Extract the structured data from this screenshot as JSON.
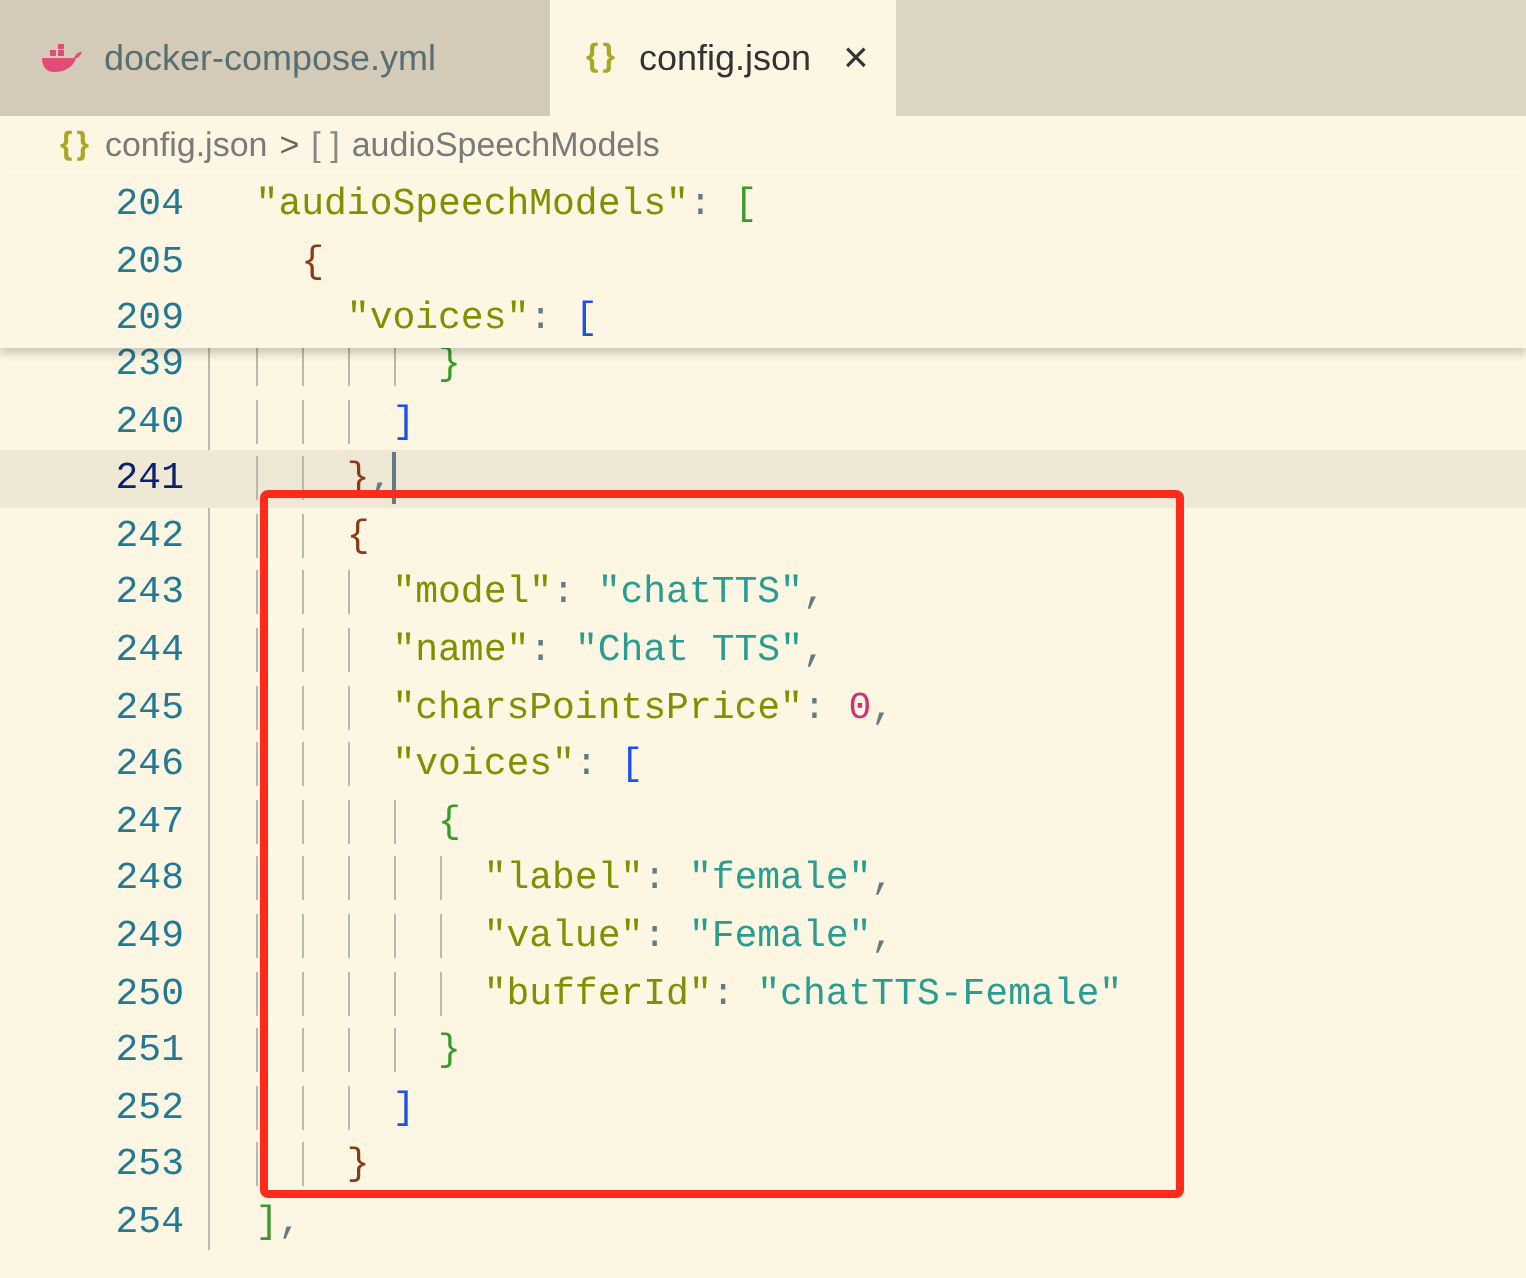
{
  "tabs": [
    {
      "label": "docker-compose.yml",
      "selected": false
    },
    {
      "label": "config.json",
      "icon_glyph": "{}",
      "close": "×",
      "selected": true
    }
  ],
  "breadcrumb": [
    {
      "glyph": "{}",
      "label": "config.json",
      "kind": "file"
    },
    {
      "glyph": ">",
      "kind": "separator"
    },
    {
      "glyph": "[ ]",
      "label": "audioSpeechModels",
      "kind": "array"
    }
  ],
  "editor": {
    "sticky_lines": [
      {
        "number": "204",
        "tokens": [
          {
            "text": "  \"audioSpeechModels\"",
            "kind": "key"
          },
          {
            "text": ": ",
            "kind": "punct"
          },
          {
            "text": "[",
            "kind": "bracket",
            "color": "#3a9b2a"
          }
        ]
      },
      {
        "number": "205",
        "tokens": [
          {
            "text": "    {",
            "kind": "bracket",
            "color": "#8b3a1a"
          }
        ]
      },
      {
        "number": "209",
        "tokens": [
          {
            "text": "      \"voices\"",
            "kind": "key"
          },
          {
            "text": ": ",
            "kind": "punct"
          },
          {
            "text": "[",
            "kind": "bracket",
            "color": "#1a4ff0"
          }
        ]
      }
    ],
    "lines": [
      {
        "number": "239",
        "current": false,
        "cursor": false,
        "tokens": [
          {
            "text": "          }",
            "kind": "bracket",
            "color": "#3a9b2a"
          }
        ]
      },
      {
        "number": "240",
        "current": false,
        "cursor": false,
        "tokens": [
          {
            "text": "        ]",
            "kind": "bracket",
            "color": "#1a4ff0"
          }
        ]
      },
      {
        "number": "241",
        "current": true,
        "cursor": true,
        "tokens": [
          {
            "text": "      }",
            "kind": "bracket",
            "color": "#8b3a1a"
          },
          {
            "text": ",",
            "kind": "punct"
          }
        ]
      },
      {
        "number": "242",
        "current": false,
        "cursor": false,
        "tokens": [
          {
            "text": "      {",
            "kind": "bracket",
            "color": "#8b3a1a"
          }
        ]
      },
      {
        "number": "243",
        "current": false,
        "cursor": false,
        "tokens": [
          {
            "text": "        \"model\"",
            "kind": "key"
          },
          {
            "text": ": ",
            "kind": "punct"
          },
          {
            "text": "\"chatTTS\"",
            "kind": "string"
          },
          {
            "text": ",",
            "kind": "punct"
          }
        ]
      },
      {
        "number": "244",
        "current": false,
        "cursor": false,
        "tokens": [
          {
            "text": "        \"name\"",
            "kind": "key"
          },
          {
            "text": ": ",
            "kind": "punct"
          },
          {
            "text": "\"Chat TTS\"",
            "kind": "string"
          },
          {
            "text": ",",
            "kind": "punct"
          }
        ]
      },
      {
        "number": "245",
        "current": false,
        "cursor": false,
        "tokens": [
          {
            "text": "        \"charsPointsPrice\"",
            "kind": "key"
          },
          {
            "text": ": ",
            "kind": "punct"
          },
          {
            "text": "0",
            "kind": "number"
          },
          {
            "text": ",",
            "kind": "punct"
          }
        ]
      },
      {
        "number": "246",
        "current": false,
        "cursor": false,
        "tokens": [
          {
            "text": "        \"voices\"",
            "kind": "key"
          },
          {
            "text": ": ",
            "kind": "punct"
          },
          {
            "text": "[",
            "kind": "bracket",
            "color": "#1a4ff0"
          }
        ]
      },
      {
        "number": "247",
        "current": false,
        "cursor": false,
        "tokens": [
          {
            "text": "          {",
            "kind": "bracket",
            "color": "#3a9b2a"
          }
        ]
      },
      {
        "number": "248",
        "current": false,
        "cursor": false,
        "tokens": [
          {
            "text": "            \"label\"",
            "kind": "key"
          },
          {
            "text": ": ",
            "kind": "punct"
          },
          {
            "text": "\"female\"",
            "kind": "string"
          },
          {
            "text": ",",
            "kind": "punct"
          }
        ]
      },
      {
        "number": "249",
        "current": false,
        "cursor": false,
        "tokens": [
          {
            "text": "            \"value\"",
            "kind": "key"
          },
          {
            "text": ": ",
            "kind": "punct"
          },
          {
            "text": "\"Female\"",
            "kind": "string"
          },
          {
            "text": ",",
            "kind": "punct"
          }
        ]
      },
      {
        "number": "250",
        "current": false,
        "cursor": false,
        "tokens": [
          {
            "text": "            \"bufferId\"",
            "kind": "key"
          },
          {
            "text": ": ",
            "kind": "punct"
          },
          {
            "text": "\"chatTTS-Female\"",
            "kind": "string"
          }
        ]
      },
      {
        "number": "251",
        "current": false,
        "cursor": false,
        "tokens": [
          {
            "text": "          }",
            "kind": "bracket",
            "color": "#3a9b2a"
          }
        ]
      },
      {
        "number": "252",
        "current": false,
        "cursor": false,
        "tokens": [
          {
            "text": "        ]",
            "kind": "bracket",
            "color": "#1a4ff0"
          }
        ]
      },
      {
        "number": "253",
        "current": false,
        "cursor": false,
        "tokens": [
          {
            "text": "      }",
            "kind": "bracket",
            "color": "#8b3a1a"
          }
        ]
      },
      {
        "number": "254",
        "current": false,
        "cursor": false,
        "tokens": [
          {
            "text": "  ]",
            "kind": "bracket",
            "color": "#3a9b2a"
          },
          {
            "text": ",",
            "kind": "punct"
          }
        ]
      }
    ]
  }
}
